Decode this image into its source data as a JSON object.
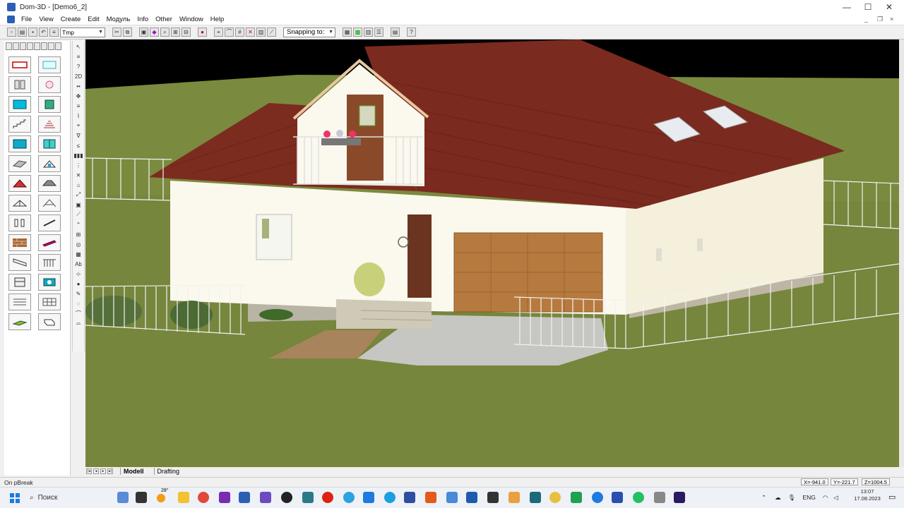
{
  "window": {
    "title": "Dom-3D - [Demo6_2]",
    "controls": {
      "minimize": "—",
      "maximize": "☐",
      "close": "✕"
    },
    "mdi_controls": {
      "minimize": "_",
      "restore": "❐",
      "close": "×"
    }
  },
  "menu": {
    "items": [
      "File",
      "View",
      "Create",
      "Edit",
      "Модуль",
      "Info",
      "Other",
      "Window",
      "Help"
    ]
  },
  "toolbar": {
    "layer_combo_value": "Tmp",
    "snapping_label": "Snapping to:",
    "help_glyph": "?"
  },
  "vertical_toolbar": {
    "items": [
      "↖",
      "≡",
      "?",
      "2D",
      "••",
      "✥",
      "≡",
      "⌇",
      "⌖",
      "∇",
      "≤",
      "▮▮▮",
      "⋮",
      "✕",
      "⌂",
      "⤢",
      "▣",
      "⟋",
      "⌃",
      "⊞",
      "◎",
      "▦",
      "Ab",
      "⊹",
      "●",
      "✎",
      "◌",
      "⌒",
      "⌓"
    ]
  },
  "bottom_tabs": {
    "nav": [
      "|◂",
      "◂",
      "▸",
      "▸|"
    ],
    "tabs": [
      {
        "label": "Modell",
        "active": true
      },
      {
        "label": "Drafting",
        "active": false
      }
    ]
  },
  "status": {
    "left": "On pBreak",
    "x": "X=-941.0",
    "y": "Y=-221.7",
    "z": "Z=1004.5"
  },
  "taskbar": {
    "search_placeholder": "Поиск",
    "weather": "28°",
    "language": "ENG",
    "time": "13:07",
    "date": "17.08.2023"
  },
  "scene": {
    "sky_color": "#000000",
    "grass_color": "#7a8a3e",
    "roof_color": "#7a2a1e",
    "wall_color": "#fbf8ee",
    "garage_color": "#b77a3e",
    "door_color": "#6a3420",
    "pavement_color": "#c6c6c2"
  }
}
